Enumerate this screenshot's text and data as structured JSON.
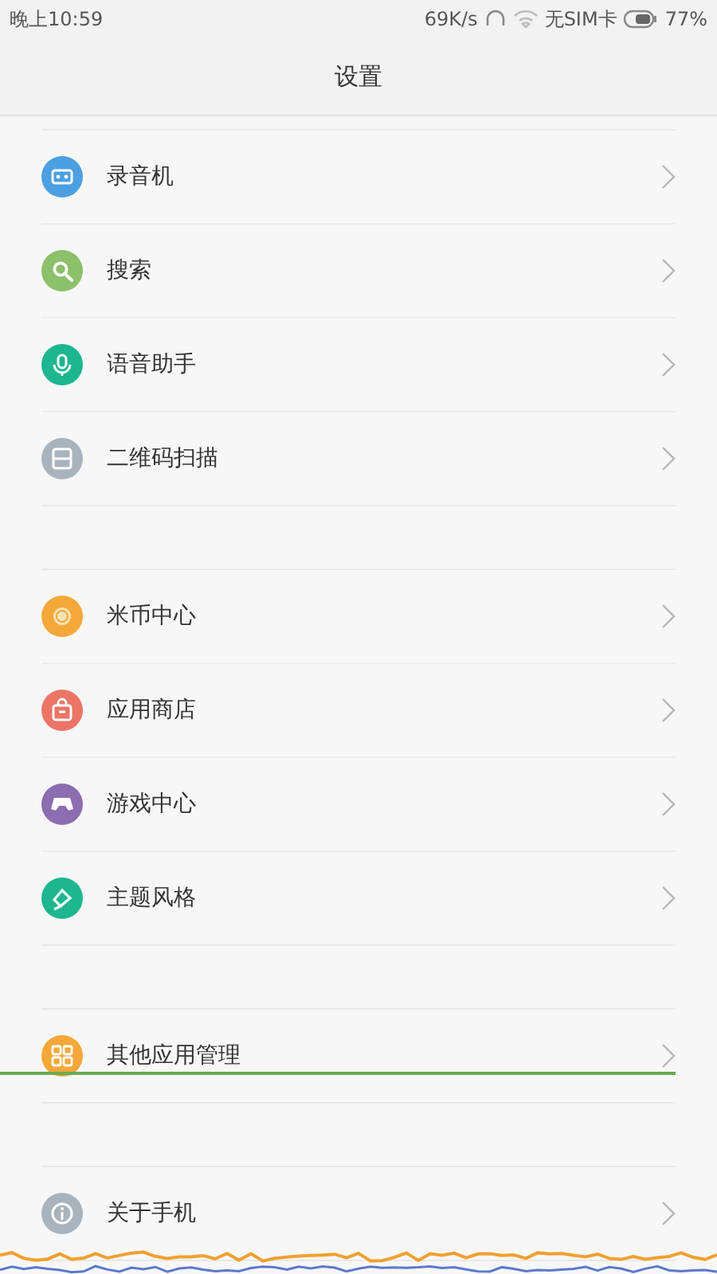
{
  "status_bar": {
    "time": "晚上10:59",
    "speed": "69K/s",
    "carrier": "无SIM卡",
    "battery": "77%"
  },
  "header": {
    "title": "设置"
  },
  "groups": [
    {
      "items": [
        {
          "label": "录音机",
          "color": "#4c9fe0"
        },
        {
          "label": "搜索",
          "color": "#8cc06a"
        },
        {
          "label": "语音助手",
          "color": "#1db68e"
        },
        {
          "label": "二维码扫描",
          "color": "#a9b3bd"
        }
      ]
    },
    {
      "items": [
        {
          "label": "米币中心",
          "color": "#f4a83a"
        },
        {
          "label": "应用商店",
          "color": "#ec7565"
        },
        {
          "label": "游戏中心",
          "color": "#8b6db0"
        },
        {
          "label": "主题风格",
          "color": "#1db68e"
        }
      ]
    },
    {
      "items": [
        {
          "label": "其他应用管理",
          "color": "#f4a83a"
        }
      ]
    },
    {
      "items": [
        {
          "label": "关于手机",
          "color": "#a9b3bd"
        }
      ]
    }
  ]
}
